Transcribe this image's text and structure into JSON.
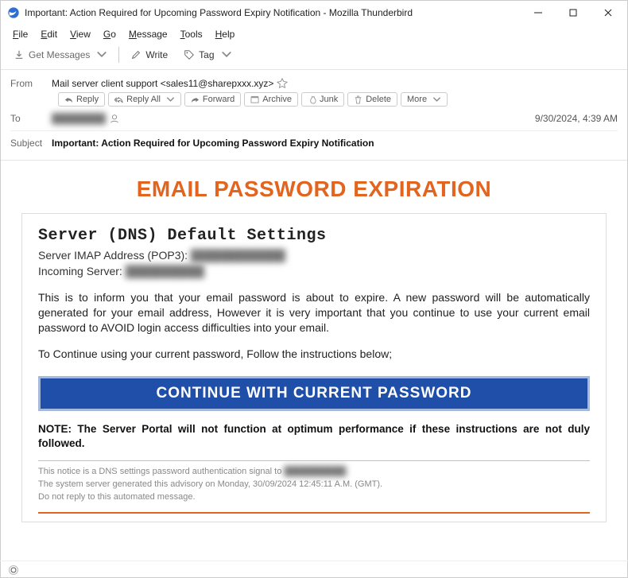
{
  "window": {
    "title": "Important: Action Required for Upcoming Password Expiry Notification - Mozilla Thunderbird"
  },
  "menu": {
    "file": "File",
    "edit": "Edit",
    "view": "View",
    "go": "Go",
    "message": "Message",
    "tools": "Tools",
    "help": "Help"
  },
  "toolbar": {
    "get_messages": "Get Messages",
    "write": "Write",
    "tag": "Tag"
  },
  "headers": {
    "from_label": "From",
    "from_value": "Mail server client support <sales11@sharepxxx.xyz>",
    "to_label": "To",
    "to_value_blurred": "████████",
    "subject_label": "Subject",
    "subject_value": "Important: Action Required for Upcoming Password Expiry Notification",
    "date": "9/30/2024, 4:39 AM"
  },
  "actions": {
    "reply": "Reply",
    "reply_all": "Reply All",
    "forward": "Forward",
    "archive": "Archive",
    "junk": "Junk",
    "delete": "Delete",
    "more": "More"
  },
  "email": {
    "banner": "EMAIL PASSWORD EXPIRATION",
    "h2": "Server (DNS) Default Settings",
    "imap_label": "Server IMAP Address (POP3): ",
    "imap_value_blurred": "████████████",
    "incoming_label": "Incoming Server: ",
    "incoming_value_blurred": "██████████",
    "para1": "This is to inform you that your email password is about to expire. A new password will be automatically generated for your email address, However it is very important that you continue to use your current email password to AVOID login access difficulties into your email.",
    "para2": "To Continue using your current password, Follow the instructions below;",
    "cta": "CONTINUE WITH CURRENT PASSWORD",
    "note": "NOTE: The Server Portal will not function at optimum performance if these instructions are not duly followed.",
    "fine1a": "This notice is a DNS settings password authentication signal to ",
    "fine1b_blurred": "██████████",
    "fine2": "The system server generated this advisory on Monday, 30/09/2024 12:45:11 A.M. (GMT).",
    "fine3": "Do not reply to this automated message."
  }
}
